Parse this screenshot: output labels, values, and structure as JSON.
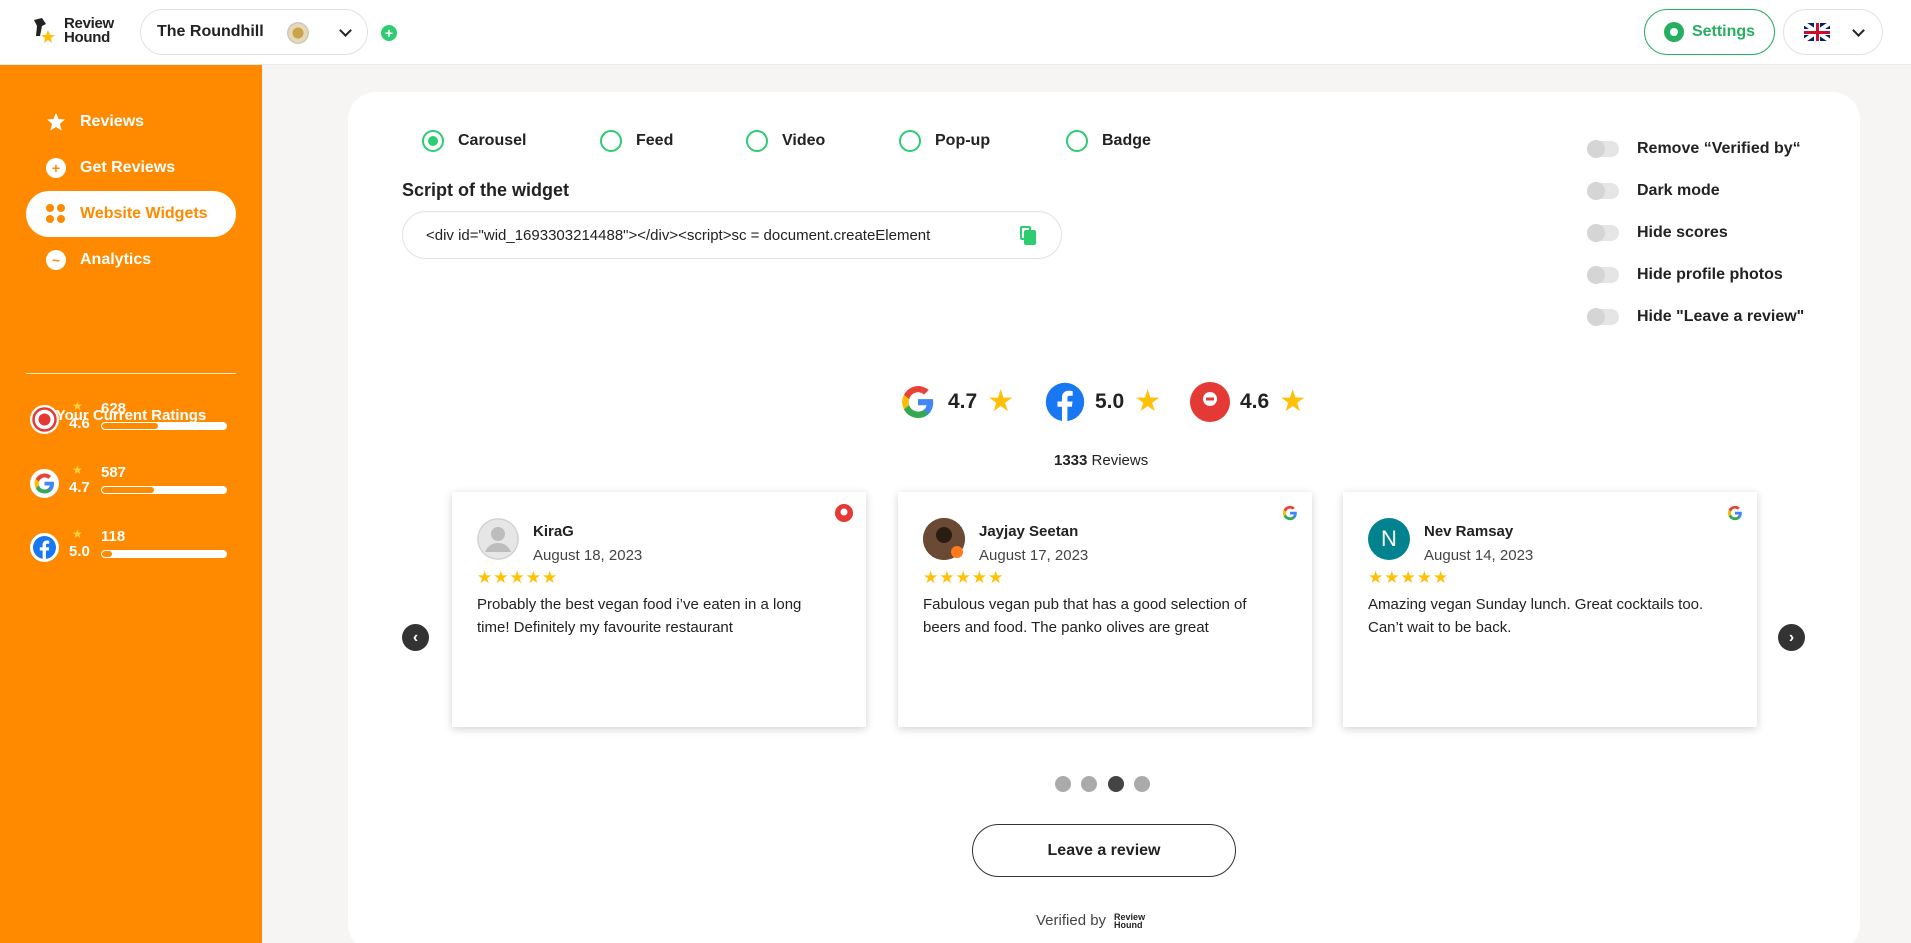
{
  "header": {
    "logo_text_line1": "Review",
    "logo_text_line2": "Hound",
    "venue_name": "The Roundhill",
    "add_label": "+",
    "settings_label": "Settings"
  },
  "sidebar": {
    "items": [
      {
        "label": "Reviews",
        "icon": "star-icon"
      },
      {
        "label": "Get Reviews",
        "icon": "plus-circle-icon"
      },
      {
        "label": "Website Widgets",
        "icon": "grid-icon"
      },
      {
        "label": "Analytics",
        "icon": "chart-icon"
      }
    ],
    "ratings_title": "Your Current Ratings",
    "ratings": [
      {
        "platform": "OpenRice",
        "score": "4.6",
        "count": "628",
        "fill": 0.45
      },
      {
        "platform": "Google",
        "score": "4.7",
        "count": "587",
        "fill": 0.42
      },
      {
        "platform": "Facebook",
        "score": "5.0",
        "count": "118",
        "fill": 0.08
      }
    ]
  },
  "widget_types": [
    {
      "label": "Carousel",
      "checked": true
    },
    {
      "label": "Feed",
      "checked": false
    },
    {
      "label": "Video",
      "checked": false
    },
    {
      "label": "Pop-up",
      "checked": false
    },
    {
      "label": "Badge",
      "checked": false
    }
  ],
  "script": {
    "label": "Script of the widget",
    "value": "<div id=\"wid_1693303214488\"></div><script>sc = document.createElement"
  },
  "toggles": [
    {
      "label": "Remove “Verified by“"
    },
    {
      "label": "Dark mode"
    },
    {
      "label": "Hide scores"
    },
    {
      "label": "Hide profile photos"
    },
    {
      "label": "Hide \"Leave a review\""
    }
  ],
  "summary": {
    "platforms": [
      {
        "name": "Google",
        "score": "4.7"
      },
      {
        "name": "Facebook",
        "score": "5.0"
      },
      {
        "name": "OpenRice",
        "score": "4.6"
      }
    ],
    "total_count": "1333",
    "total_label": "Reviews"
  },
  "reviews": [
    {
      "name": "KiraG",
      "date": "August 18, 2023",
      "stars": "★★★★★",
      "text": "Probably the best vegan food i’ve eaten in a long time! Definitely my favourite restaurant",
      "source": "openrice",
      "avatar_letter": ""
    },
    {
      "name": "Jayjay Seetan",
      "date": "August 17, 2023",
      "stars": "★★★★★",
      "text": "Fabulous vegan pub that has a good selection of beers and food. The panko olives are great",
      "source": "google",
      "avatar_letter": ""
    },
    {
      "name": "Nev Ramsay",
      "date": "August 14, 2023",
      "stars": "★★★★★",
      "text": "Amazing vegan Sunday lunch. Great cocktails too. Can’t wait to be back.",
      "source": "google",
      "avatar_letter": "N"
    }
  ],
  "carousel": {
    "prev_label": "‹",
    "next_label": "›",
    "active_page": 3,
    "pages": 4
  },
  "leave_review_label": "Leave a review",
  "verified_label": "Verified by",
  "colors": {
    "brand_orange": "#ff8a00",
    "accent_green": "#2ecc71",
    "star_yellow": "#ffc107"
  }
}
